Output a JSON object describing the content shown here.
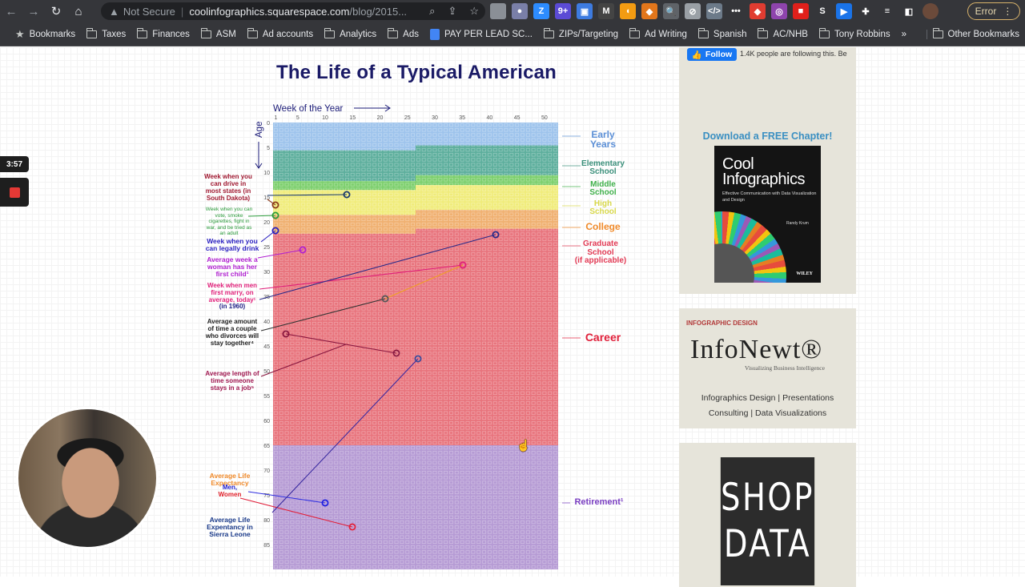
{
  "browser": {
    "nav": {
      "back": "←",
      "forward": "→",
      "reload": "↻",
      "home": "⌂"
    },
    "security_label": "Not Secure",
    "url_host": "coolinfographics.squarespace.com",
    "url_path": "/blog/2015...",
    "extensions": [
      {
        "name": "puzzle-ext",
        "glyph": "",
        "color": "#8a8f96"
      },
      {
        "name": "circle-ext",
        "glyph": "●",
        "color": "#7a7fa8"
      },
      {
        "name": "zoom-ext",
        "glyph": "Z",
        "color": "#2d8cff"
      },
      {
        "name": "badge-ext",
        "glyph": "9+",
        "color": "#5b4bd5"
      },
      {
        "name": "blue-ext",
        "glyph": "▣",
        "color": "#3d7be0"
      },
      {
        "name": "m-ext",
        "glyph": "M",
        "color": "#444"
      },
      {
        "name": "flame-ext",
        "glyph": "◖",
        "color": "#f39c12"
      },
      {
        "name": "fox-ext",
        "glyph": "◆",
        "color": "#e2761b"
      },
      {
        "name": "magnifier-ext",
        "glyph": "🔍",
        "color": "#5f6368"
      },
      {
        "name": "link-ext",
        "glyph": "⊘",
        "color": "#9aa0a6"
      },
      {
        "name": "code-ext",
        "glyph": "</>",
        "color": "#6c7a89"
      },
      {
        "name": "dots-ext",
        "glyph": "•••",
        "color": "#35363a"
      },
      {
        "name": "red-ext",
        "glyph": "◆",
        "color": "#e03c31"
      },
      {
        "name": "ring-ext",
        "glyph": "◎",
        "color": "#8e44ad"
      },
      {
        "name": "record-ext",
        "glyph": "■",
        "color": "#e0201b"
      },
      {
        "name": "s-ext",
        "glyph": "S",
        "color": "#35363a"
      },
      {
        "name": "flag-ext",
        "glyph": "▶",
        "color": "#1a73e8"
      },
      {
        "name": "puzzle-menu",
        "glyph": "✚",
        "color": "#35363a"
      },
      {
        "name": "media-ext",
        "glyph": "≡",
        "color": "#35363a"
      },
      {
        "name": "sidepanel-ext",
        "glyph": "◧",
        "color": "#35363a"
      },
      {
        "name": "profile-avatar",
        "glyph": "●",
        "color": "#6b4a3a"
      }
    ],
    "error_label": "Error",
    "bookmarks": [
      "Bookmarks",
      "Taxes",
      "Finances",
      "ASM",
      "Ad accounts",
      "Analytics",
      "Ads",
      "PAY PER LEAD SC...",
      "ZIPs/Targeting",
      "Ad Writing",
      "Spanish",
      "AC/NHB",
      "Tony Robbins"
    ],
    "more_bookmarks": "»",
    "other_bookmarks": "Other Bookmarks"
  },
  "recorder": {
    "elapsed": "3:57"
  },
  "infographic": {
    "title": "The Life of a Typical American",
    "x_axis_label": "Week of the Year",
    "y_axis_label": "Age",
    "x_ticks": [
      "1",
      "5",
      "10",
      "15",
      "20",
      "25",
      "30",
      "35",
      "40",
      "45",
      "50"
    ],
    "y_ticks": [
      "0",
      "5",
      "10",
      "15",
      "20",
      "25",
      "30",
      "35",
      "40",
      "45",
      "50",
      "55",
      "60",
      "65",
      "70",
      "75",
      "80",
      "85"
    ],
    "stages": [
      {
        "label": "Early Years",
        "color": "#5b8fd6"
      },
      {
        "label": "Elementary School",
        "color": "#3a8f7a"
      },
      {
        "label": "Middle School",
        "color": "#3fb04a"
      },
      {
        "label": "High School",
        "color": "#d8d84a"
      },
      {
        "label": "College",
        "color": "#f08a2a"
      },
      {
        "label": "Graduate School (if applicable)",
        "color": "#e23b55"
      },
      {
        "label": "Career",
        "color": "#e0203a"
      },
      {
        "label": "Retirement¹",
        "color": "#7a3fc2"
      }
    ],
    "annotations": [
      {
        "text": "Week when you can drive in most states (in South Dakota)",
        "color": "#a01830"
      },
      {
        "text": "Week when you can vote, smoke cigarettes, fight in war, and be tried as an adult",
        "color": "#2a9a3a"
      },
      {
        "text": "Week when you can legally drink",
        "color": "#2a20c0"
      },
      {
        "text": "Average week a woman has her first child¹",
        "color": "#b020d0"
      },
      {
        "text": "Week when men first marry, on average, today¹",
        "color": "#e0207a"
      },
      {
        "text": "(in 1960)",
        "color": "#222288"
      },
      {
        "text": "Average amount of time a couple who divorces will stay together⁴",
        "color": "#222222"
      },
      {
        "text": "Average length of time someone stays in a job⁵",
        "color": "#a01850"
      },
      {
        "text": "Average Life Expectancy",
        "color": "#f08a2a"
      },
      {
        "text": "Men,",
        "color": "#2020d0"
      },
      {
        "text": "Women",
        "color": "#e0202a"
      },
      {
        "text": "Average Life Expentancy in Sierra Leone",
        "color": "#1a3a8a"
      }
    ]
  },
  "sidebar": {
    "follow_button": "Follow",
    "follow_text": "1.4K people are following this. Be",
    "download_cta": "Download a FREE Chapter!",
    "book": {
      "title": "Cool Infographics",
      "subtitle": "Effective Communication with Data Visualization and Design",
      "author": "Randy Krum",
      "publisher": "WILEY"
    },
    "ad": {
      "tag": "INFOGRAPHIC DESIGN",
      "logo": "InfoNewt®",
      "tagline": "Visualizing Business Intelligence",
      "services_line1": "Infographics Design | Presentations",
      "services_line2": "Consulting | Data Visualizations"
    },
    "shop": {
      "line1": "SHOP",
      "line2": "DATA"
    }
  }
}
